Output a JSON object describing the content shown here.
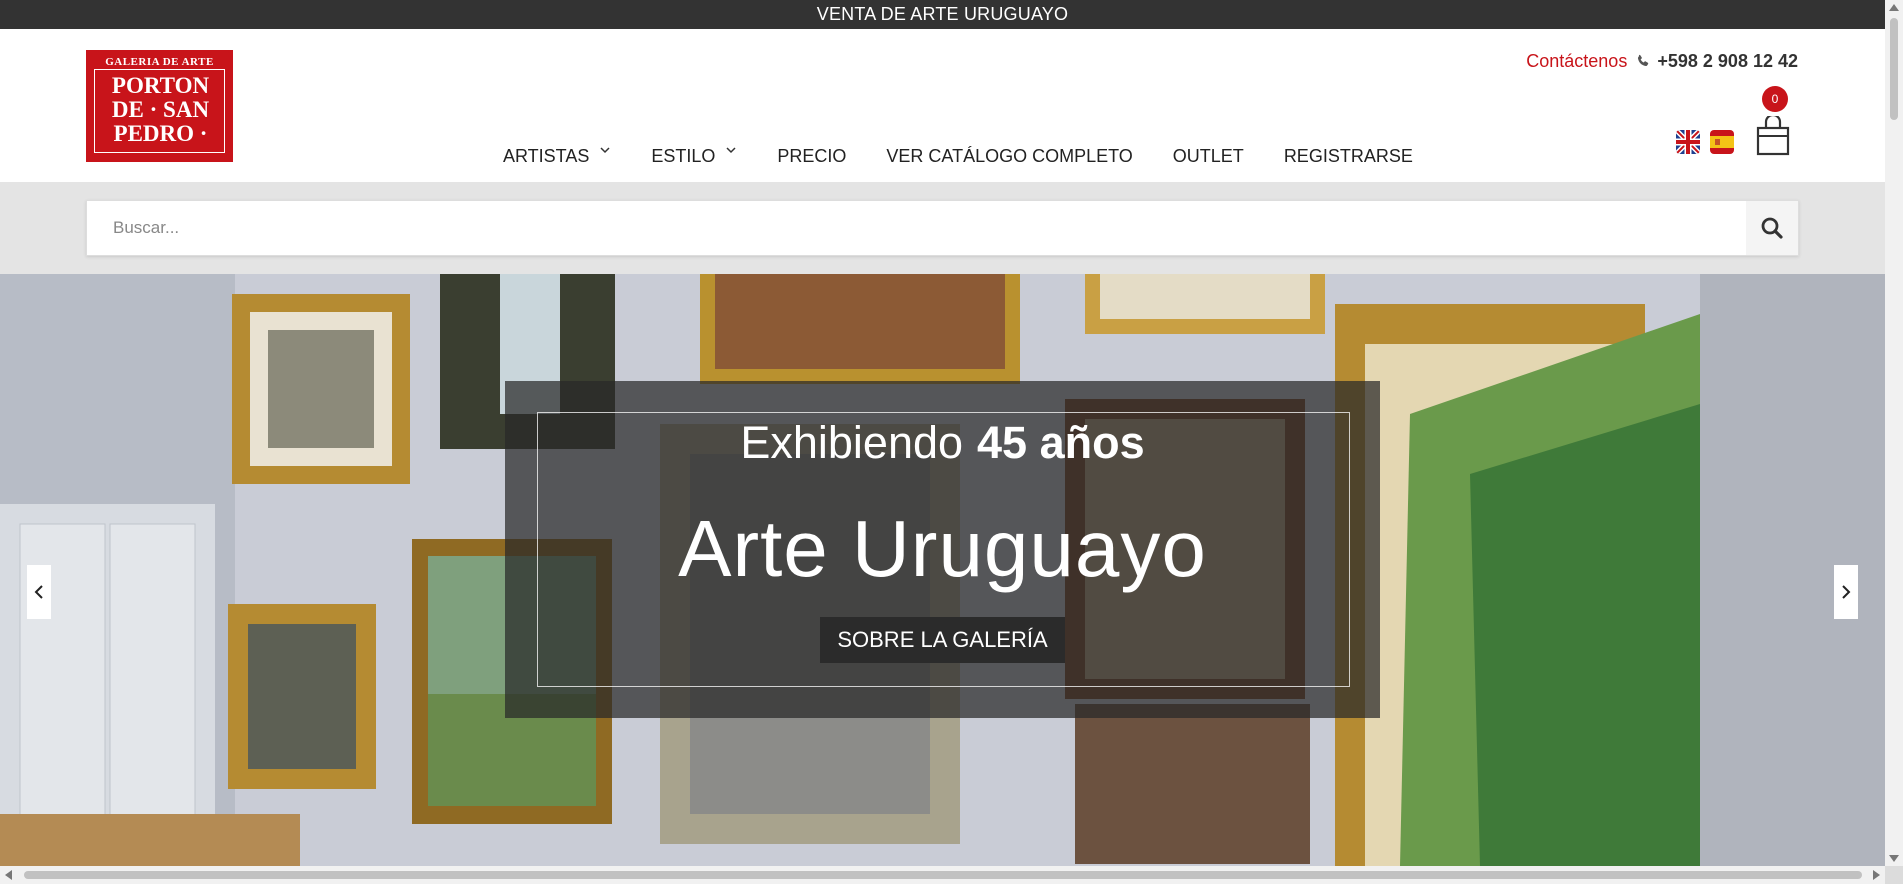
{
  "top_bar": {
    "text": "VENTA DE ARTE URUGUAYO"
  },
  "logo": {
    "top_text": "GALERIA DE ARTE",
    "line1": "PORTON",
    "line2": "DE · SAN",
    "line3": "PEDRO ·"
  },
  "contact": {
    "link_label": "Contáctenos",
    "phone": "+598 2 908 12 42",
    "icon": "phone-icon"
  },
  "nav": {
    "items": [
      {
        "label": "ARTISTAS",
        "dropdown": true
      },
      {
        "label": "ESTILO",
        "dropdown": true
      },
      {
        "label": "PRECIO",
        "dropdown": false
      },
      {
        "label": "VER CATÁLOGO COMPLETO",
        "dropdown": false
      },
      {
        "label": "OUTLET",
        "dropdown": false
      },
      {
        "label": "REGISTRARSE",
        "dropdown": false
      }
    ]
  },
  "languages": [
    {
      "code": "en",
      "icon": "uk-flag-icon"
    },
    {
      "code": "es",
      "icon": "spain-flag-icon"
    }
  ],
  "cart": {
    "count": "0",
    "icon": "shopping-bag-icon"
  },
  "search": {
    "placeholder": "Buscar...",
    "value": "",
    "icon": "search-icon"
  },
  "hero": {
    "line1_prefix": "Exhibiendo",
    "line1_strong": "45 años",
    "title": "Arte Uruguayo",
    "button_label": "SOBRE LA GALERÍA"
  },
  "colors": {
    "brand_red": "#c8141a",
    "top_bar_bg": "#333333",
    "search_band_bg": "#e4e4e4"
  }
}
